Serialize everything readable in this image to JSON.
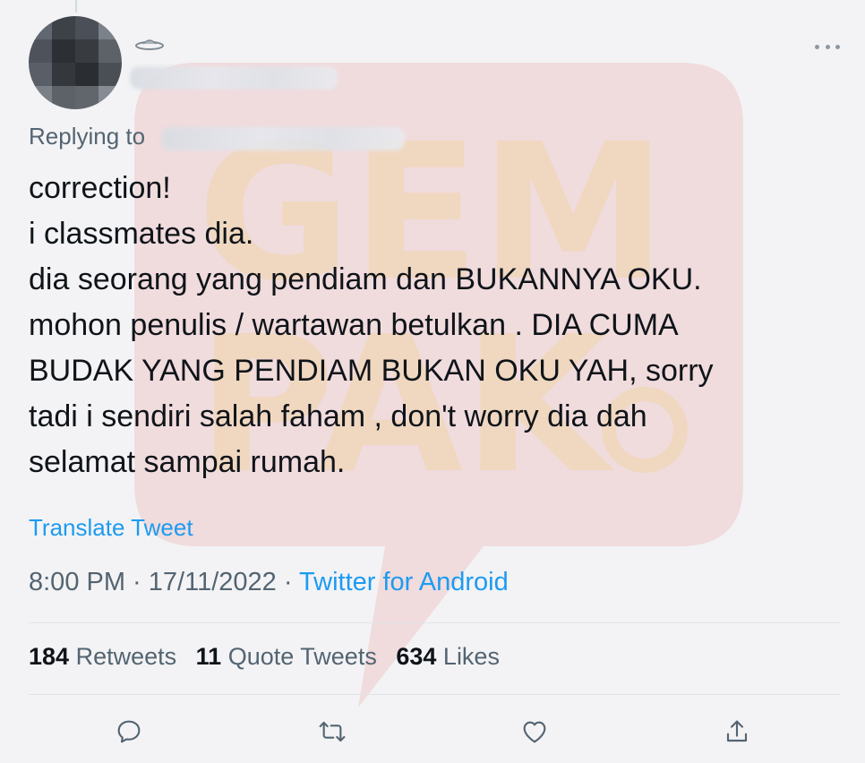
{
  "tweet": {
    "display_name": "",
    "replying_to_label": "Replying to",
    "text": "correction!\ni classmates dia.\ndia seorang yang pendiam dan BUKANNYA OKU.\nmohon penulis / wartawan betulkan . DIA CUMA\nBUDAK YANG PENDIAM BUKAN OKU YAH, sorry\ntadi i sendiri salah faham , don't worry dia dah\nselamat sampai rumah.",
    "translate_label": "Translate Tweet",
    "time": "8:00 PM",
    "date": "17/11/2022",
    "separator": " · ",
    "source": "Twitter for Android"
  },
  "stats": {
    "retweets_count": "184",
    "retweets_label": "Retweets",
    "quotes_count": "11",
    "quotes_label": "Quote Tweets",
    "likes_count": "634",
    "likes_label": "Likes"
  },
  "watermark": {
    "line1": "GEM",
    "line2": "PAK",
    "bubble_color": "#e03a3e",
    "text_color": "#f4c430"
  },
  "icons": {
    "more": "more-horizontal-icon",
    "reply": "reply-icon",
    "retweet": "retweet-icon",
    "like": "heart-icon",
    "share": "share-icon"
  },
  "colors": {
    "accent": "#1d9bf0",
    "secondary_text": "#536471",
    "primary_text": "#0f1419"
  }
}
